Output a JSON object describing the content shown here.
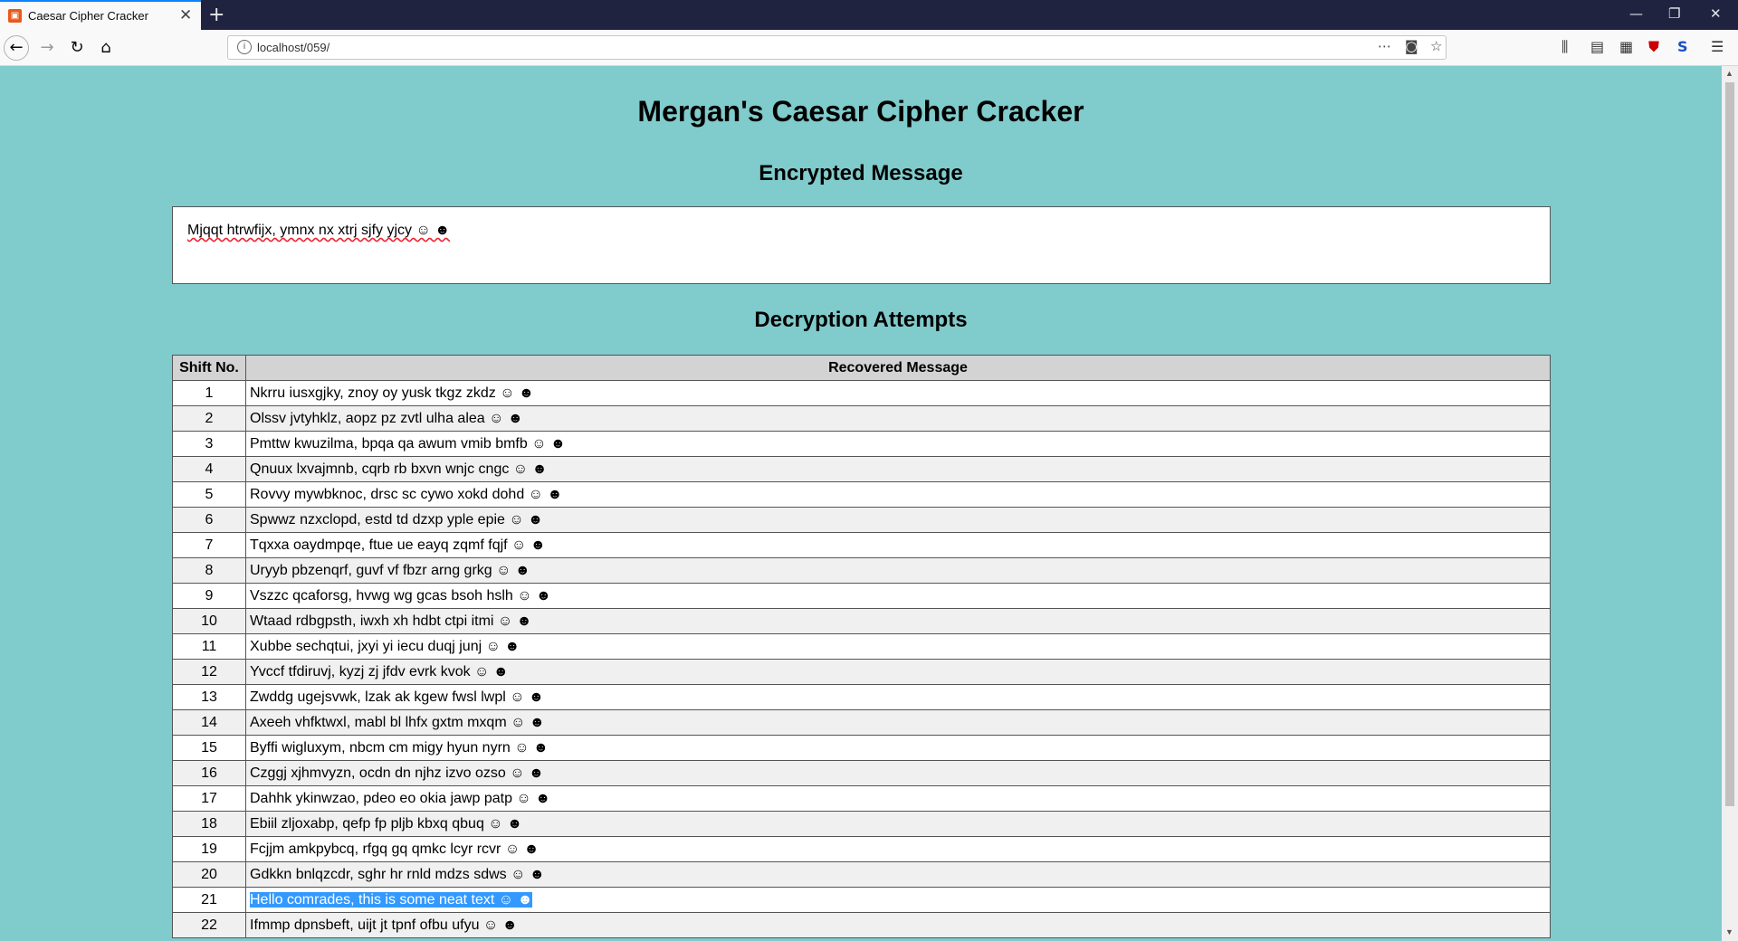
{
  "browser": {
    "tab_title": "Caesar Cipher Cracker",
    "url": "localhost/059/",
    "new_tab": "+",
    "tab_close": "✕"
  },
  "page": {
    "title": "Mergan's Caesar Cipher Cracker",
    "encrypted_heading": "Encrypted Message",
    "encrypted_message": "Mjqqt htrwfijx, ymnx nx xtrj sjfy yjcy ☺ ☻",
    "decryption_heading": "Decryption Attempts",
    "table": {
      "columns": [
        "Shift No.",
        "Recovered Message"
      ],
      "rows": [
        {
          "shift": "1",
          "message": "Nkrru iusxgjky, znoy oy yusk tkgz zkdz ☺ ☻"
        },
        {
          "shift": "2",
          "message": "Olssv jvtyhklz, aopz pz zvtl ulha alea ☺ ☻"
        },
        {
          "shift": "3",
          "message": "Pmttw kwuzilma, bpqa qa awum vmib bmfb ☺ ☻"
        },
        {
          "shift": "4",
          "message": "Qnuux lxvajmnb, cqrb rb bxvn wnjc cngc ☺ ☻"
        },
        {
          "shift": "5",
          "message": "Rovvy mywbknoc, drsc sc cywo xokd dohd ☺ ☻"
        },
        {
          "shift": "6",
          "message": "Spwwz nzxclopd, estd td dzxp yple epie ☺ ☻"
        },
        {
          "shift": "7",
          "message": "Tqxxa oaydmpqe, ftue ue eayq zqmf fqjf ☺ ☻"
        },
        {
          "shift": "8",
          "message": "Uryyb pbzenqrf, guvf vf fbzr arng grkg ☺ ☻"
        },
        {
          "shift": "9",
          "message": "Vszzc qcaforsg, hvwg wg gcas bsoh hslh ☺ ☻"
        },
        {
          "shift": "10",
          "message": "Wtaad rdbgpsth, iwxh xh hdbt ctpi itmi ☺ ☻"
        },
        {
          "shift": "11",
          "message": "Xubbe sechqtui, jxyi yi iecu duqj junj ☺ ☻"
        },
        {
          "shift": "12",
          "message": "Yvccf tfdiruvj, kyzj zj jfdv evrk kvok ☺ ☻"
        },
        {
          "shift": "13",
          "message": "Zwddg ugejsvwk, lzak ak kgew fwsl lwpl ☺ ☻"
        },
        {
          "shift": "14",
          "message": "Axeeh vhfktwxl, mabl bl lhfx gxtm mxqm ☺ ☻"
        },
        {
          "shift": "15",
          "message": "Byffi wigluxym, nbcm cm migy hyun nyrn ☺ ☻"
        },
        {
          "shift": "16",
          "message": "Czggj xjhmvyzn, ocdn dn njhz izvo ozso ☺ ☻"
        },
        {
          "shift": "17",
          "message": "Dahhk ykinwzao, pdeo eo okia jawp patp ☺ ☻"
        },
        {
          "shift": "18",
          "message": "Ebiil zljoxabp, qefp fp pljb kbxq qbuq ☺ ☻"
        },
        {
          "shift": "19",
          "message": "Fcjjm amkpybcq, rfgq gq qmkc lcyr rcvr ☺ ☻"
        },
        {
          "shift": "20",
          "message": "Gdkkn bnlqzcdr, sghr hr rnld mdzs sdws ☺ ☻"
        },
        {
          "shift": "21",
          "message": "Hello comrades, this is some neat text ☺ ☻",
          "selected": true
        },
        {
          "shift": "22",
          "message": "Ifmmp dpnsbeft, uijt jt tpnf ofbu ufyu ☺ ☻"
        }
      ]
    }
  }
}
